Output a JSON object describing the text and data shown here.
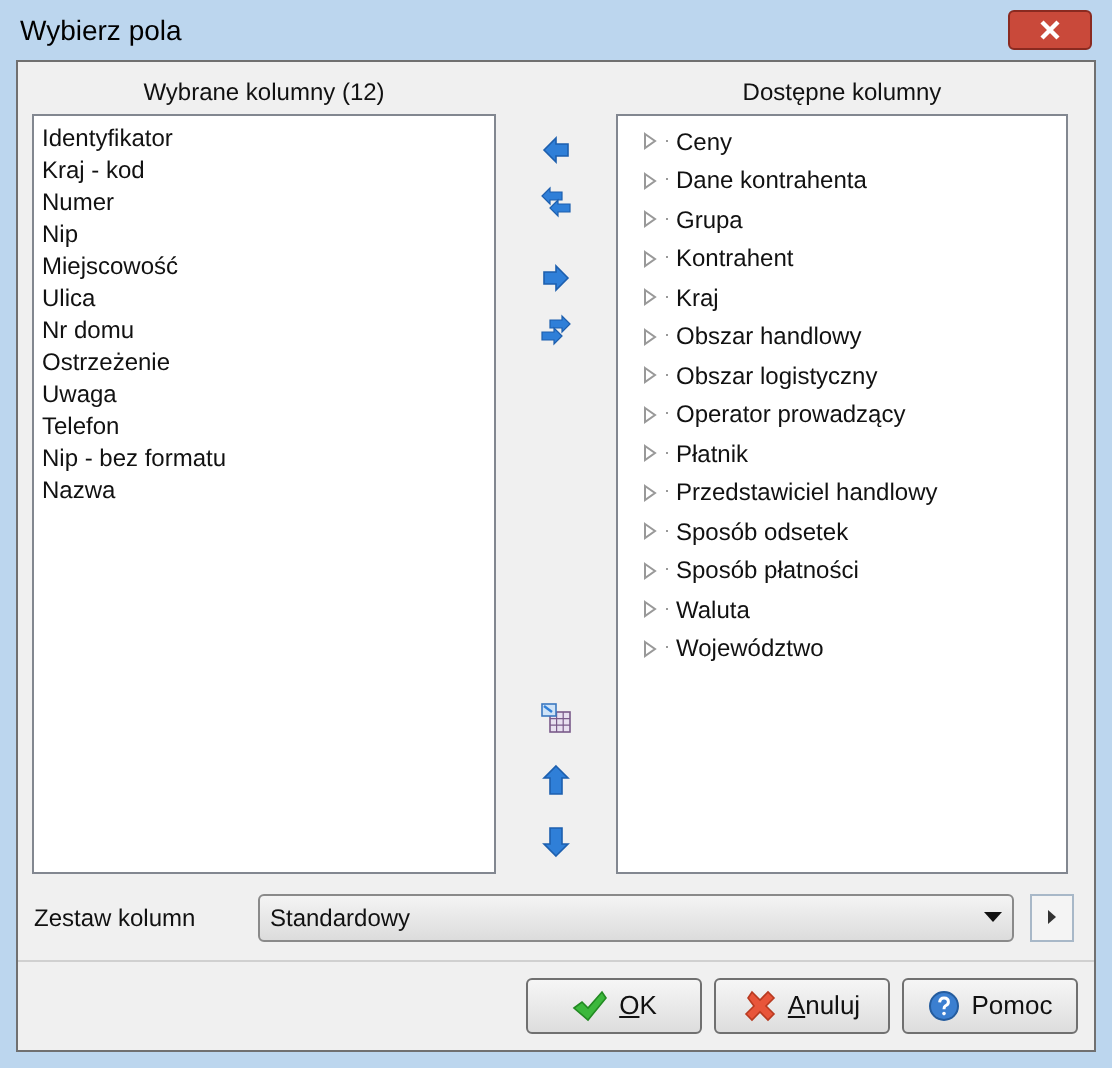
{
  "window": {
    "title": "Wybierz pola"
  },
  "selected_columns": {
    "title": "Wybrane kolumny (12)",
    "items": [
      {
        "label": "Identyfikator",
        "selected": false
      },
      {
        "label": "Kraj - kod",
        "selected": false
      },
      {
        "label": "Numer",
        "selected": false
      },
      {
        "label": "Nip",
        "selected": false
      },
      {
        "label": "Miejscowość",
        "selected": false
      },
      {
        "label": "Ulica",
        "selected": false
      },
      {
        "label": "Nr domu",
        "selected": false
      },
      {
        "label": "Ostrzeżenie",
        "selected": false
      },
      {
        "label": "Uwaga",
        "selected": false
      },
      {
        "label": "Telefon",
        "selected": false
      },
      {
        "label": "Nip - bez formatu",
        "selected": false
      },
      {
        "label": "Nazwa",
        "selected": false
      }
    ]
  },
  "move_buttons": [
    {
      "kind": "left"
    },
    {
      "kind": "all-left"
    },
    {
      "kind": "right"
    },
    {
      "kind": "all-right"
    }
  ],
  "order_buttons": [
    {
      "kind": "grid"
    },
    {
      "kind": "up"
    },
    {
      "kind": "down"
    }
  ],
  "available_columns": {
    "title": "Dostępne kolumny",
    "items": [
      {
        "label": "Ceny",
        "expanded": false
      },
      {
        "label": "Dane kontrahenta",
        "expanded": false
      },
      {
        "label": "Grupa",
        "expanded": false
      },
      {
        "label": "Kontrahent",
        "expanded": false
      },
      {
        "label": "Kraj",
        "expanded": false
      },
      {
        "label": "Obszar handlowy",
        "expanded": false
      },
      {
        "label": "Obszar logistyczny",
        "expanded": false
      },
      {
        "label": "Operator prowadzący",
        "expanded": false
      },
      {
        "label": "Płatnik",
        "expanded": false
      },
      {
        "label": "Przedstawiciel handlowy",
        "expanded": false
      },
      {
        "label": "Sposób odsetek",
        "expanded": false
      },
      {
        "label": "Sposób płatności",
        "expanded": false
      },
      {
        "label": "Waluta",
        "expanded": false
      },
      {
        "label": "Województwo",
        "expanded": false
      }
    ]
  },
  "column_set": {
    "label": "Zestaw kolumn",
    "value": "Standardowy"
  },
  "buttons": [
    {
      "kind": "ok",
      "label": "OK",
      "access_key": true
    },
    {
      "kind": "cancel",
      "label": "Anuluj",
      "access_key": true
    },
    {
      "kind": "help",
      "label": "Pomoc",
      "access_key": false
    }
  ]
}
